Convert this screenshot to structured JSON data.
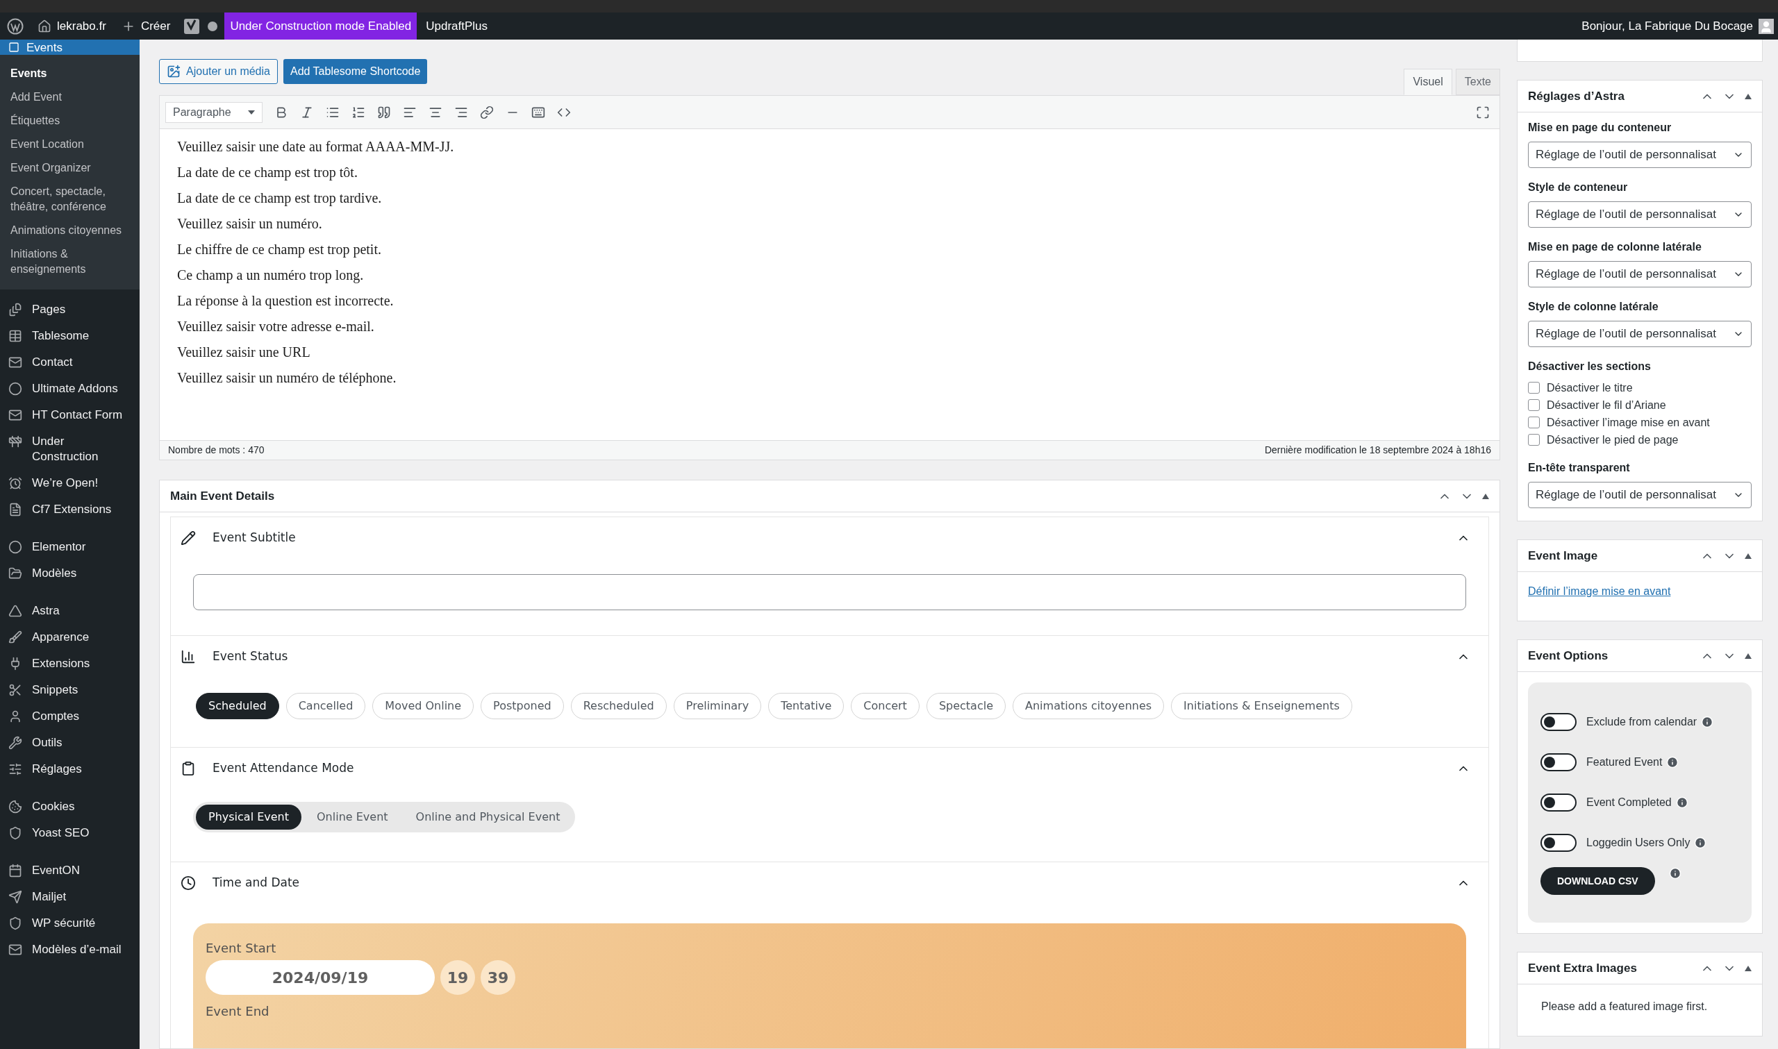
{
  "admin_bar": {
    "site": "lekrabo.fr",
    "create": "Créer",
    "notice": "Under Construction mode Enabled",
    "plugin": "UpdraftPlus",
    "greeting": "Bonjour, La Fabrique Du Bocage"
  },
  "sidebar": {
    "current": "Events",
    "submenu": [
      {
        "label": "Events",
        "selected": true
      },
      {
        "label": "Add Event",
        "selected": false
      },
      {
        "label": "Étiquettes",
        "selected": false
      },
      {
        "label": "Event Location",
        "selected": false
      },
      {
        "label": "Event Organizer",
        "selected": false
      },
      {
        "label": "Concert, spectacle, théâtre, conférence",
        "selected": false
      },
      {
        "label": "Animations citoyennes",
        "selected": false
      },
      {
        "label": "Initiations & enseignements",
        "selected": false
      }
    ],
    "groups": [
      [
        "Pages",
        "Tablesome",
        "Contact",
        "Ultimate Addons",
        "HT Contact Form",
        "Under Construction",
        "We’re Open!",
        "Cf7 Extensions"
      ],
      [
        "Elementor",
        "Modèles"
      ],
      [
        "Astra",
        "Apparence",
        "Extensions",
        "Snippets",
        "Comptes",
        "Outils",
        "Réglages"
      ],
      [
        "Cookies",
        "Yoast SEO"
      ],
      [
        "EventON",
        "Mailjet",
        "WP sécurité",
        "Modèles d’e-mail"
      ]
    ]
  },
  "editor": {
    "buttons": [
      "Ajouter un média",
      "Add Tablesome Shortcode"
    ],
    "tabs": [
      {
        "label": "Visuel",
        "selected": true
      },
      {
        "label": "Texte",
        "selected": false
      }
    ],
    "format": "Paragraphe",
    "lines": [
      "Veuillez saisir une date au format AAAA-MM-JJ.",
      "La date de ce champ est trop tôt.",
      "La date de ce champ est trop tardive.",
      "Veuillez saisir un numéro.",
      "Le chiffre de ce champ est trop petit.",
      "Ce champ a un numéro trop long.",
      "La réponse à la question est incorrecte.",
      "Veuillez saisir votre adresse e-mail.",
      "Veuillez saisir une URL",
      "Veuillez saisir un numéro de téléphone."
    ],
    "word_count": "Nombre de mots : 470",
    "last_modified": "Dernière modification le 18 septembre 2024 à 18h16"
  },
  "main_event_details": {
    "title": "Main Event Details",
    "subtitle": {
      "heading": "Event Subtitle"
    },
    "status": {
      "heading": "Event Status",
      "options": [
        {
          "label": "Scheduled",
          "selected": true
        },
        {
          "label": "Cancelled",
          "selected": false
        },
        {
          "label": "Moved Online",
          "selected": false
        },
        {
          "label": "Postponed",
          "selected": false
        },
        {
          "label": "Rescheduled",
          "selected": false
        },
        {
          "label": "Preliminary",
          "selected": false
        },
        {
          "label": "Tentative",
          "selected": false
        },
        {
          "label": "Concert",
          "selected": false
        },
        {
          "label": "Spectacle",
          "selected": false
        },
        {
          "label": "Animations citoyennes",
          "selected": false
        },
        {
          "label": "Initiations & Enseignements",
          "selected": false
        }
      ]
    },
    "attendance": {
      "heading": "Event Attendance Mode",
      "options": [
        {
          "label": "Physical Event",
          "selected": true
        },
        {
          "label": "Online Event",
          "selected": false
        },
        {
          "label": "Online and Physical Event",
          "selected": false
        }
      ]
    },
    "time_date": {
      "heading": "Time and Date",
      "start_label": "Event Start",
      "date": "2024/09/19",
      "hour": "19",
      "minute": "39",
      "end_label": "Event End"
    }
  },
  "astra": {
    "title": "Réglages d’Astra",
    "fields": [
      {
        "label": "Mise en page du conteneur",
        "value": "Réglage de l’outil de personnalisat"
      },
      {
        "label": "Style de conteneur",
        "value": "Réglage de l’outil de personnalisat"
      },
      {
        "label": "Mise en page de colonne latérale",
        "value": "Réglage de l’outil de personnalisat"
      },
      {
        "label": "Style de colonne latérale",
        "value": "Réglage de l’outil de personnalisat"
      }
    ],
    "sections_label": "Désactiver les sections",
    "checkboxes": [
      {
        "label": "Désactiver le titre",
        "checked": false
      },
      {
        "label": "Désactiver le fil d’Ariane",
        "checked": false
      },
      {
        "label": "Désactiver l’image mise en avant",
        "checked": false
      },
      {
        "label": "Désactiver le pied de page",
        "checked": false
      }
    ],
    "header_field": {
      "label": "En-tête transparent",
      "value": "Réglage de l’outil de personnalisat"
    }
  },
  "event_image": {
    "title": "Event Image",
    "link": "Définir l’image mise en avant"
  },
  "event_options": {
    "title": "Event Options",
    "toggles": [
      {
        "label": "Exclude from calendar",
        "on": false
      },
      {
        "label": "Featured Event",
        "on": false
      },
      {
        "label": "Event Completed",
        "on": false
      },
      {
        "label": "Loggedin Users Only",
        "on": false
      }
    ],
    "download": "DOWNLOAD CSV"
  },
  "extra_images": {
    "title": "Event Extra Images",
    "message": "Please add a featured image first."
  }
}
